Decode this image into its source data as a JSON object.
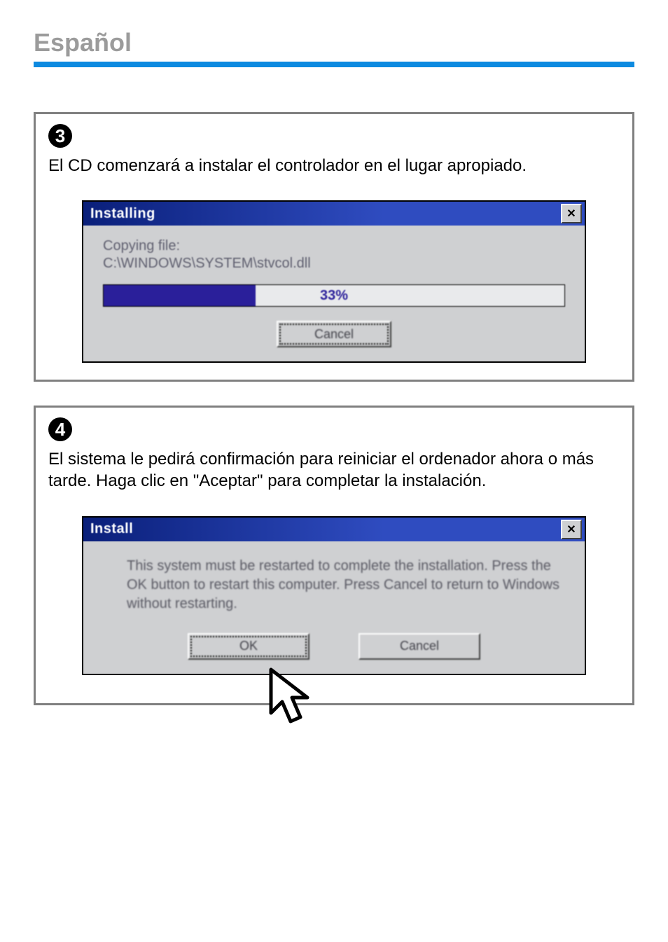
{
  "page": {
    "language_header": "Español"
  },
  "step3": {
    "number": "3",
    "instruction": "El CD comenzará a instalar el controlador en el lugar apropiado.",
    "dialog": {
      "title": "Installing",
      "copying_label": "Copying file:",
      "path": "C:\\WINDOWS\\SYSTEM\\stvcol.dll",
      "progress_percent": 33,
      "progress_label": "33%",
      "cancel_label": "Cancel"
    }
  },
  "step4": {
    "number": "4",
    "instruction": "El sistema le pedirá confirmación para reiniciar el ordenador ahora o más tarde. Haga clic en  \"Aceptar\" para completar la instalación.",
    "dialog": {
      "title": "Install",
      "message": "This system must be restarted to complete the installation. Press the OK button to restart this computer. Press Cancel to return to Windows without restarting.",
      "ok_label": "OK",
      "cancel_label": "Cancel"
    }
  }
}
